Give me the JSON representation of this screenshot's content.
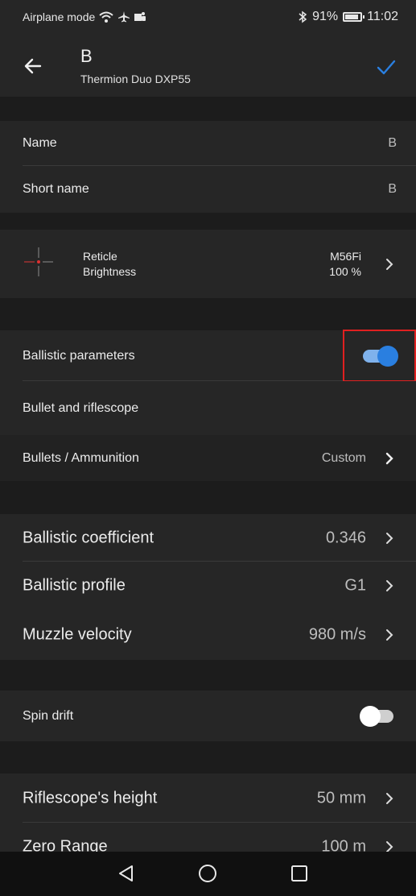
{
  "status_bar": {
    "left_text": "Airplane mode",
    "battery_text": "91%",
    "time": "11:02"
  },
  "toolbar": {
    "title": "B",
    "subtitle": "Thermion Duo DXP55",
    "back_icon": "arrow-left-icon",
    "confirm_icon": "checkmark-icon",
    "accent_color": "#2a7fe0"
  },
  "profile": {
    "name_label": "Name",
    "name_value": "B",
    "short_name_label": "Short name",
    "short_name_value": "B"
  },
  "reticle": {
    "label": "Reticle",
    "brightness_label": "Brightness",
    "value": "M56Fi",
    "brightness_value": "100 %"
  },
  "ballistic": {
    "label": "Ballistic parameters",
    "enabled": true
  },
  "bullet_section": {
    "header": "Bullet and riflescope",
    "bullets_label": "Bullets / Ammunition",
    "bullets_value": "Custom"
  },
  "coefficients": {
    "bc_label": "Ballistic coefficient",
    "bc_value": "0.346",
    "profile_label": "Ballistic profile",
    "profile_value": "G1",
    "velocity_label": "Muzzle velocity",
    "velocity_value": "980 m/s"
  },
  "spin_drift": {
    "label": "Spin drift",
    "enabled": false
  },
  "scope": {
    "height_label": "Riflescope's height",
    "height_value": "50 mm",
    "zero_label": "Zero Range",
    "zero_value": "100 m"
  },
  "nav_bar": {
    "back_icon": "triangle-back-icon",
    "home_icon": "circle-home-icon",
    "recents_icon": "square-recents-icon"
  }
}
